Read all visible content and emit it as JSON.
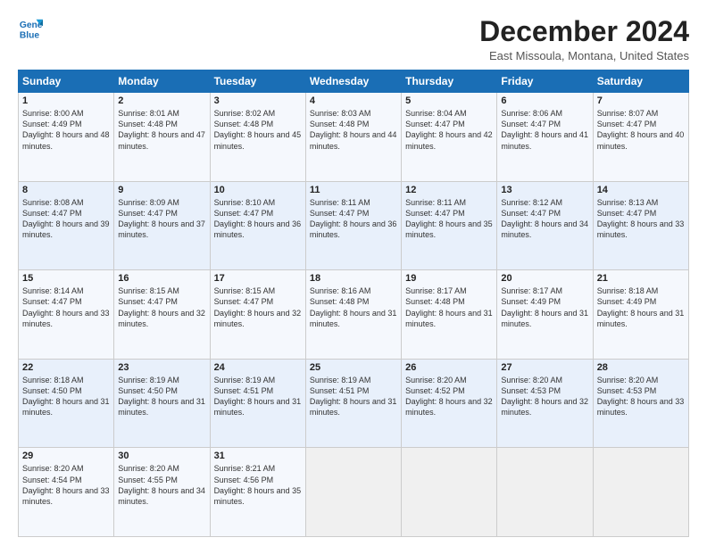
{
  "logo": {
    "line1": "General",
    "line2": "Blue"
  },
  "header": {
    "title": "December 2024",
    "subtitle": "East Missoula, Montana, United States"
  },
  "weekdays": [
    "Sunday",
    "Monday",
    "Tuesday",
    "Wednesday",
    "Thursday",
    "Friday",
    "Saturday"
  ],
  "weeks": [
    [
      {
        "day": "1",
        "sunrise": "8:00 AM",
        "sunset": "4:49 PM",
        "daylight": "8 hours and 48 minutes."
      },
      {
        "day": "2",
        "sunrise": "8:01 AM",
        "sunset": "4:48 PM",
        "daylight": "8 hours and 47 minutes."
      },
      {
        "day": "3",
        "sunrise": "8:02 AM",
        "sunset": "4:48 PM",
        "daylight": "8 hours and 45 minutes."
      },
      {
        "day": "4",
        "sunrise": "8:03 AM",
        "sunset": "4:48 PM",
        "daylight": "8 hours and 44 minutes."
      },
      {
        "day": "5",
        "sunrise": "8:04 AM",
        "sunset": "4:47 PM",
        "daylight": "8 hours and 42 minutes."
      },
      {
        "day": "6",
        "sunrise": "8:06 AM",
        "sunset": "4:47 PM",
        "daylight": "8 hours and 41 minutes."
      },
      {
        "day": "7",
        "sunrise": "8:07 AM",
        "sunset": "4:47 PM",
        "daylight": "8 hours and 40 minutes."
      }
    ],
    [
      {
        "day": "8",
        "sunrise": "8:08 AM",
        "sunset": "4:47 PM",
        "daylight": "8 hours and 39 minutes."
      },
      {
        "day": "9",
        "sunrise": "8:09 AM",
        "sunset": "4:47 PM",
        "daylight": "8 hours and 37 minutes."
      },
      {
        "day": "10",
        "sunrise": "8:10 AM",
        "sunset": "4:47 PM",
        "daylight": "8 hours and 36 minutes."
      },
      {
        "day": "11",
        "sunrise": "8:11 AM",
        "sunset": "4:47 PM",
        "daylight": "8 hours and 36 minutes."
      },
      {
        "day": "12",
        "sunrise": "8:11 AM",
        "sunset": "4:47 PM",
        "daylight": "8 hours and 35 minutes."
      },
      {
        "day": "13",
        "sunrise": "8:12 AM",
        "sunset": "4:47 PM",
        "daylight": "8 hours and 34 minutes."
      },
      {
        "day": "14",
        "sunrise": "8:13 AM",
        "sunset": "4:47 PM",
        "daylight": "8 hours and 33 minutes."
      }
    ],
    [
      {
        "day": "15",
        "sunrise": "8:14 AM",
        "sunset": "4:47 PM",
        "daylight": "8 hours and 33 minutes."
      },
      {
        "day": "16",
        "sunrise": "8:15 AM",
        "sunset": "4:47 PM",
        "daylight": "8 hours and 32 minutes."
      },
      {
        "day": "17",
        "sunrise": "8:15 AM",
        "sunset": "4:47 PM",
        "daylight": "8 hours and 32 minutes."
      },
      {
        "day": "18",
        "sunrise": "8:16 AM",
        "sunset": "4:48 PM",
        "daylight": "8 hours and 31 minutes."
      },
      {
        "day": "19",
        "sunrise": "8:17 AM",
        "sunset": "4:48 PM",
        "daylight": "8 hours and 31 minutes."
      },
      {
        "day": "20",
        "sunrise": "8:17 AM",
        "sunset": "4:49 PM",
        "daylight": "8 hours and 31 minutes."
      },
      {
        "day": "21",
        "sunrise": "8:18 AM",
        "sunset": "4:49 PM",
        "daylight": "8 hours and 31 minutes."
      }
    ],
    [
      {
        "day": "22",
        "sunrise": "8:18 AM",
        "sunset": "4:50 PM",
        "daylight": "8 hours and 31 minutes."
      },
      {
        "day": "23",
        "sunrise": "8:19 AM",
        "sunset": "4:50 PM",
        "daylight": "8 hours and 31 minutes."
      },
      {
        "day": "24",
        "sunrise": "8:19 AM",
        "sunset": "4:51 PM",
        "daylight": "8 hours and 31 minutes."
      },
      {
        "day": "25",
        "sunrise": "8:19 AM",
        "sunset": "4:51 PM",
        "daylight": "8 hours and 31 minutes."
      },
      {
        "day": "26",
        "sunrise": "8:20 AM",
        "sunset": "4:52 PM",
        "daylight": "8 hours and 32 minutes."
      },
      {
        "day": "27",
        "sunrise": "8:20 AM",
        "sunset": "4:53 PM",
        "daylight": "8 hours and 32 minutes."
      },
      {
        "day": "28",
        "sunrise": "8:20 AM",
        "sunset": "4:53 PM",
        "daylight": "8 hours and 33 minutes."
      }
    ],
    [
      {
        "day": "29",
        "sunrise": "8:20 AM",
        "sunset": "4:54 PM",
        "daylight": "8 hours and 33 minutes."
      },
      {
        "day": "30",
        "sunrise": "8:20 AM",
        "sunset": "4:55 PM",
        "daylight": "8 hours and 34 minutes."
      },
      {
        "day": "31",
        "sunrise": "8:21 AM",
        "sunset": "4:56 PM",
        "daylight": "8 hours and 35 minutes."
      },
      null,
      null,
      null,
      null
    ]
  ]
}
